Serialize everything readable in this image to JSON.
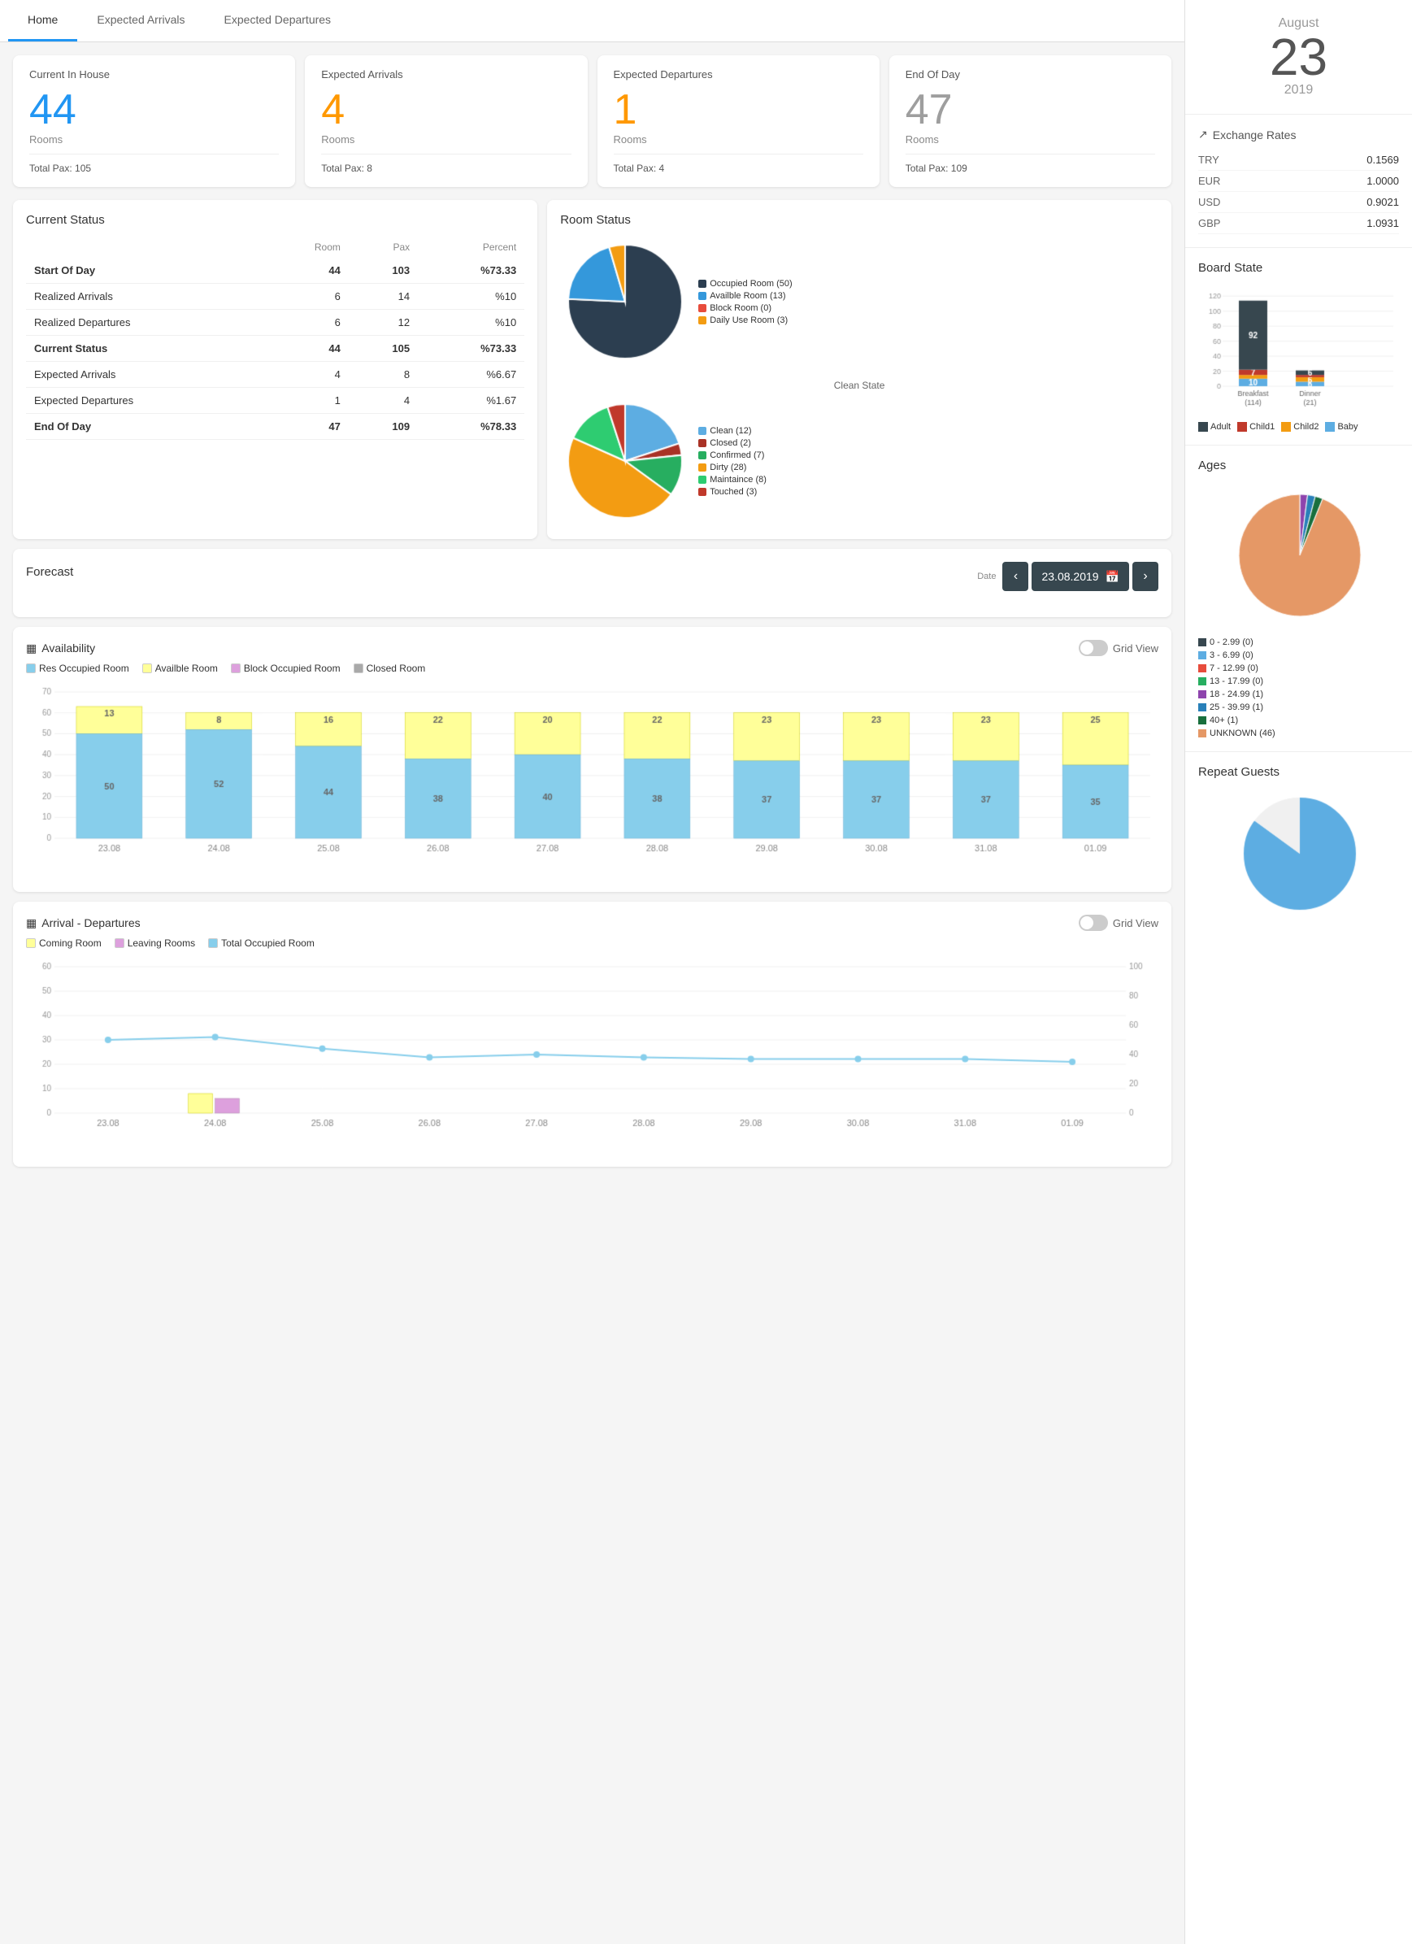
{
  "tabs": [
    {
      "label": "Home",
      "active": true
    },
    {
      "label": "Expected Arrivals",
      "active": false
    },
    {
      "label": "Expected Departures",
      "active": false
    }
  ],
  "stat_cards": [
    {
      "title": "Current In House",
      "number": "44",
      "number_color": "blue",
      "rooms_label": "Rooms",
      "pax_label": "Total Pax:",
      "pax_value": "105"
    },
    {
      "title": "Expected Arrivals",
      "number": "4",
      "number_color": "orange",
      "rooms_label": "Rooms",
      "pax_label": "Total Pax:",
      "pax_value": "8"
    },
    {
      "title": "Expected Departures",
      "number": "1",
      "number_color": "orange",
      "rooms_label": "Rooms",
      "pax_label": "Total Pax:",
      "pax_value": "4"
    },
    {
      "title": "End Of Day",
      "number": "47",
      "number_color": "gray",
      "rooms_label": "Rooms",
      "pax_label": "Total Pax:",
      "pax_value": "109"
    }
  ],
  "current_status": {
    "title": "Current Status",
    "columns": [
      "",
      "Room",
      "Pax",
      "Percent"
    ],
    "rows": [
      {
        "label": "Start Of Day",
        "room": "44",
        "pax": "103",
        "percent": "%73.33",
        "bold": true
      },
      {
        "label": "Realized Arrivals",
        "room": "6",
        "pax": "14",
        "percent": "%10",
        "bold": false
      },
      {
        "label": "Realized Departures",
        "room": "6",
        "pax": "12",
        "percent": "%10",
        "bold": false
      },
      {
        "label": "Current Status",
        "room": "44",
        "pax": "105",
        "percent": "%73.33",
        "bold": true
      },
      {
        "label": "Expected Arrivals",
        "room": "4",
        "pax": "8",
        "percent": "%6.67",
        "bold": false
      },
      {
        "label": "Expected Departures",
        "room": "1",
        "pax": "4",
        "percent": "%1.67",
        "bold": false
      },
      {
        "label": "End Of Day",
        "room": "47",
        "pax": "109",
        "percent": "%78.33",
        "bold": true
      }
    ]
  },
  "room_status": {
    "title": "Room Status",
    "pie1": {
      "segments": [
        {
          "label": "Occupied Room (50)",
          "value": 50,
          "color": "#2c3e50"
        },
        {
          "label": "Availble Room (13)",
          "value": 13,
          "color": "#3498db"
        },
        {
          "label": "Block Room (0)",
          "value": 0,
          "color": "#e74c3c"
        },
        {
          "label": "Daily Use Room (3)",
          "value": 3,
          "color": "#f39c12"
        }
      ]
    },
    "pie2": {
      "title": "Clean State",
      "segments": [
        {
          "label": "Clean (12)",
          "value": 12,
          "color": "#5dade2"
        },
        {
          "label": "Closed (2)",
          "value": 2,
          "color": "#a93226"
        },
        {
          "label": "Confirmed (7)",
          "value": 7,
          "color": "#27ae60"
        },
        {
          "label": "Dirty (28)",
          "value": 28,
          "color": "#f39c12"
        },
        {
          "label": "Maintaince (8)",
          "value": 8,
          "color": "#2ecc71"
        },
        {
          "label": "Touched (3)",
          "value": 3,
          "color": "#c0392b"
        }
      ]
    }
  },
  "forecast": {
    "title": "Forecast",
    "date_label": "Date",
    "date_value": "23.08.2019"
  },
  "availability": {
    "title": "Availability",
    "grid_view_label": "Grid View",
    "legend": [
      {
        "label": "Res Occupied Room",
        "color": "#87CEEB"
      },
      {
        "label": "Availble Room",
        "color": "#FFFF99"
      },
      {
        "label": "Block Occupied Room",
        "color": "#DDA0DD"
      },
      {
        "label": "Closed Room",
        "color": "#A9A9A9"
      }
    ],
    "y_max": 70,
    "y_ticks": [
      70,
      60,
      50,
      40,
      30,
      20,
      10,
      0
    ],
    "bars": [
      {
        "date": "23.08",
        "occupied": 50,
        "available": 13,
        "block": 0,
        "closed": 0
      },
      {
        "date": "24.08",
        "occupied": 52,
        "available": 8,
        "block": 0,
        "closed": 0
      },
      {
        "date": "25.08",
        "occupied": 44,
        "available": 16,
        "block": 0,
        "closed": 0
      },
      {
        "date": "26.08",
        "occupied": 38,
        "available": 22,
        "block": 0,
        "closed": 0
      },
      {
        "date": "27.08",
        "occupied": 40,
        "available": 20,
        "block": 0,
        "closed": 0
      },
      {
        "date": "28.08",
        "occupied": 38,
        "available": 22,
        "block": 0,
        "closed": 0
      },
      {
        "date": "29.08",
        "occupied": 37,
        "available": 23,
        "block": 0,
        "closed": 0
      },
      {
        "date": "30.08",
        "occupied": 37,
        "available": 23,
        "block": 0,
        "closed": 0
      },
      {
        "date": "31.08",
        "occupied": 37,
        "available": 23,
        "block": 0,
        "closed": 0
      },
      {
        "date": "01.09",
        "occupied": 35,
        "available": 25,
        "block": 0,
        "closed": 0
      }
    ]
  },
  "arrivals_departures": {
    "title": "Arrival - Departures",
    "grid_view_label": "Grid View",
    "legend": [
      {
        "label": "Coming Room",
        "color": "#FFFF99"
      },
      {
        "label": "Leaving Rooms",
        "color": "#DDA0DD"
      },
      {
        "label": "Total Occupied Room",
        "color": "#87CEEB"
      }
    ],
    "y_max": 60,
    "y2_max": 100,
    "bars": [
      {
        "date": "23.08",
        "coming": 0,
        "leaving": 0,
        "total": 50
      },
      {
        "date": "24.08",
        "coming": 8,
        "leaving": 6,
        "total": 52
      },
      {
        "date": "25.08",
        "coming": 0,
        "leaving": 0,
        "total": 44
      },
      {
        "date": "26.08",
        "coming": 0,
        "leaving": 0,
        "total": 38
      },
      {
        "date": "27.08",
        "coming": 0,
        "leaving": 0,
        "total": 40
      },
      {
        "date": "28.08",
        "coming": 0,
        "leaving": 0,
        "total": 38
      },
      {
        "date": "29.08",
        "coming": 0,
        "leaving": 0,
        "total": 37
      },
      {
        "date": "30.08",
        "coming": 0,
        "leaving": 0,
        "total": 37
      },
      {
        "date": "31.08",
        "coming": 0,
        "leaving": 0,
        "total": 37
      },
      {
        "date": "01.09",
        "coming": 0,
        "leaving": 0,
        "total": 35
      }
    ]
  },
  "date_widget": {
    "month": "August",
    "day": "23",
    "year": "2019"
  },
  "exchange_rates": {
    "title": "Exchange Rates",
    "rates": [
      {
        "currency": "TRY",
        "rate": "0.1569"
      },
      {
        "currency": "EUR",
        "rate": "1.0000"
      },
      {
        "currency": "USD",
        "rate": "0.9021"
      },
      {
        "currency": "GBP",
        "rate": "1.0931"
      }
    ]
  },
  "board_state": {
    "title": "Board State",
    "y_ticks": [
      "120",
      "100",
      "80",
      "60",
      "40",
      "20",
      "0"
    ],
    "bars": [
      {
        "label": "Breakfast (114)",
        "segments": [
          {
            "label": "Adult",
            "value": 92,
            "color": "#37474F"
          },
          {
            "label": "Child1",
            "value": 7,
            "color": "#c0392b"
          },
          {
            "label": "Child2",
            "value": 5,
            "color": "#f39c12"
          },
          {
            "label": "Baby",
            "value": 10,
            "color": "#5dade2"
          }
        ]
      },
      {
        "label": "Dinner (21)",
        "segments": [
          {
            "label": "Adult",
            "value": 6,
            "color": "#37474F"
          },
          {
            "label": "Child1",
            "value": 3,
            "color": "#c0392b"
          },
          {
            "label": "Child2",
            "value": 6,
            "color": "#f39c12"
          },
          {
            "label": "Baby",
            "value": 6,
            "color": "#5dade2"
          }
        ]
      }
    ],
    "legend": [
      {
        "label": "Adult",
        "color": "#37474F"
      },
      {
        "label": "Child1",
        "color": "#c0392b"
      },
      {
        "label": "Child2",
        "color": "#f39c12"
      },
      {
        "label": "Baby",
        "color": "#5dade2"
      }
    ]
  },
  "ages": {
    "title": "Ages",
    "legend": [
      {
        "label": "0 - 2.99 (0)",
        "color": "#37474F"
      },
      {
        "label": "3 - 6.99 (0)",
        "color": "#5dade2"
      },
      {
        "label": "7 - 12.99 (0)",
        "color": "#e74c3c"
      },
      {
        "label": "13 - 17.99 (0)",
        "color": "#27ae60"
      },
      {
        "label": "18 - 24.99 (1)",
        "color": "#8e44ad"
      },
      {
        "label": "25 - 39.99 (1)",
        "color": "#2980b9"
      },
      {
        "label": "40+ (1)",
        "color": "#196f3d"
      },
      {
        "label": "UNKNOWN (46)",
        "color": "#e59866"
      }
    ]
  },
  "repeat_guests": {
    "title": "Repeat Guests"
  },
  "icons": {
    "chart_bar": "▦",
    "exchange": "↗",
    "calendar": "📅",
    "prev": "‹",
    "next": "›"
  }
}
